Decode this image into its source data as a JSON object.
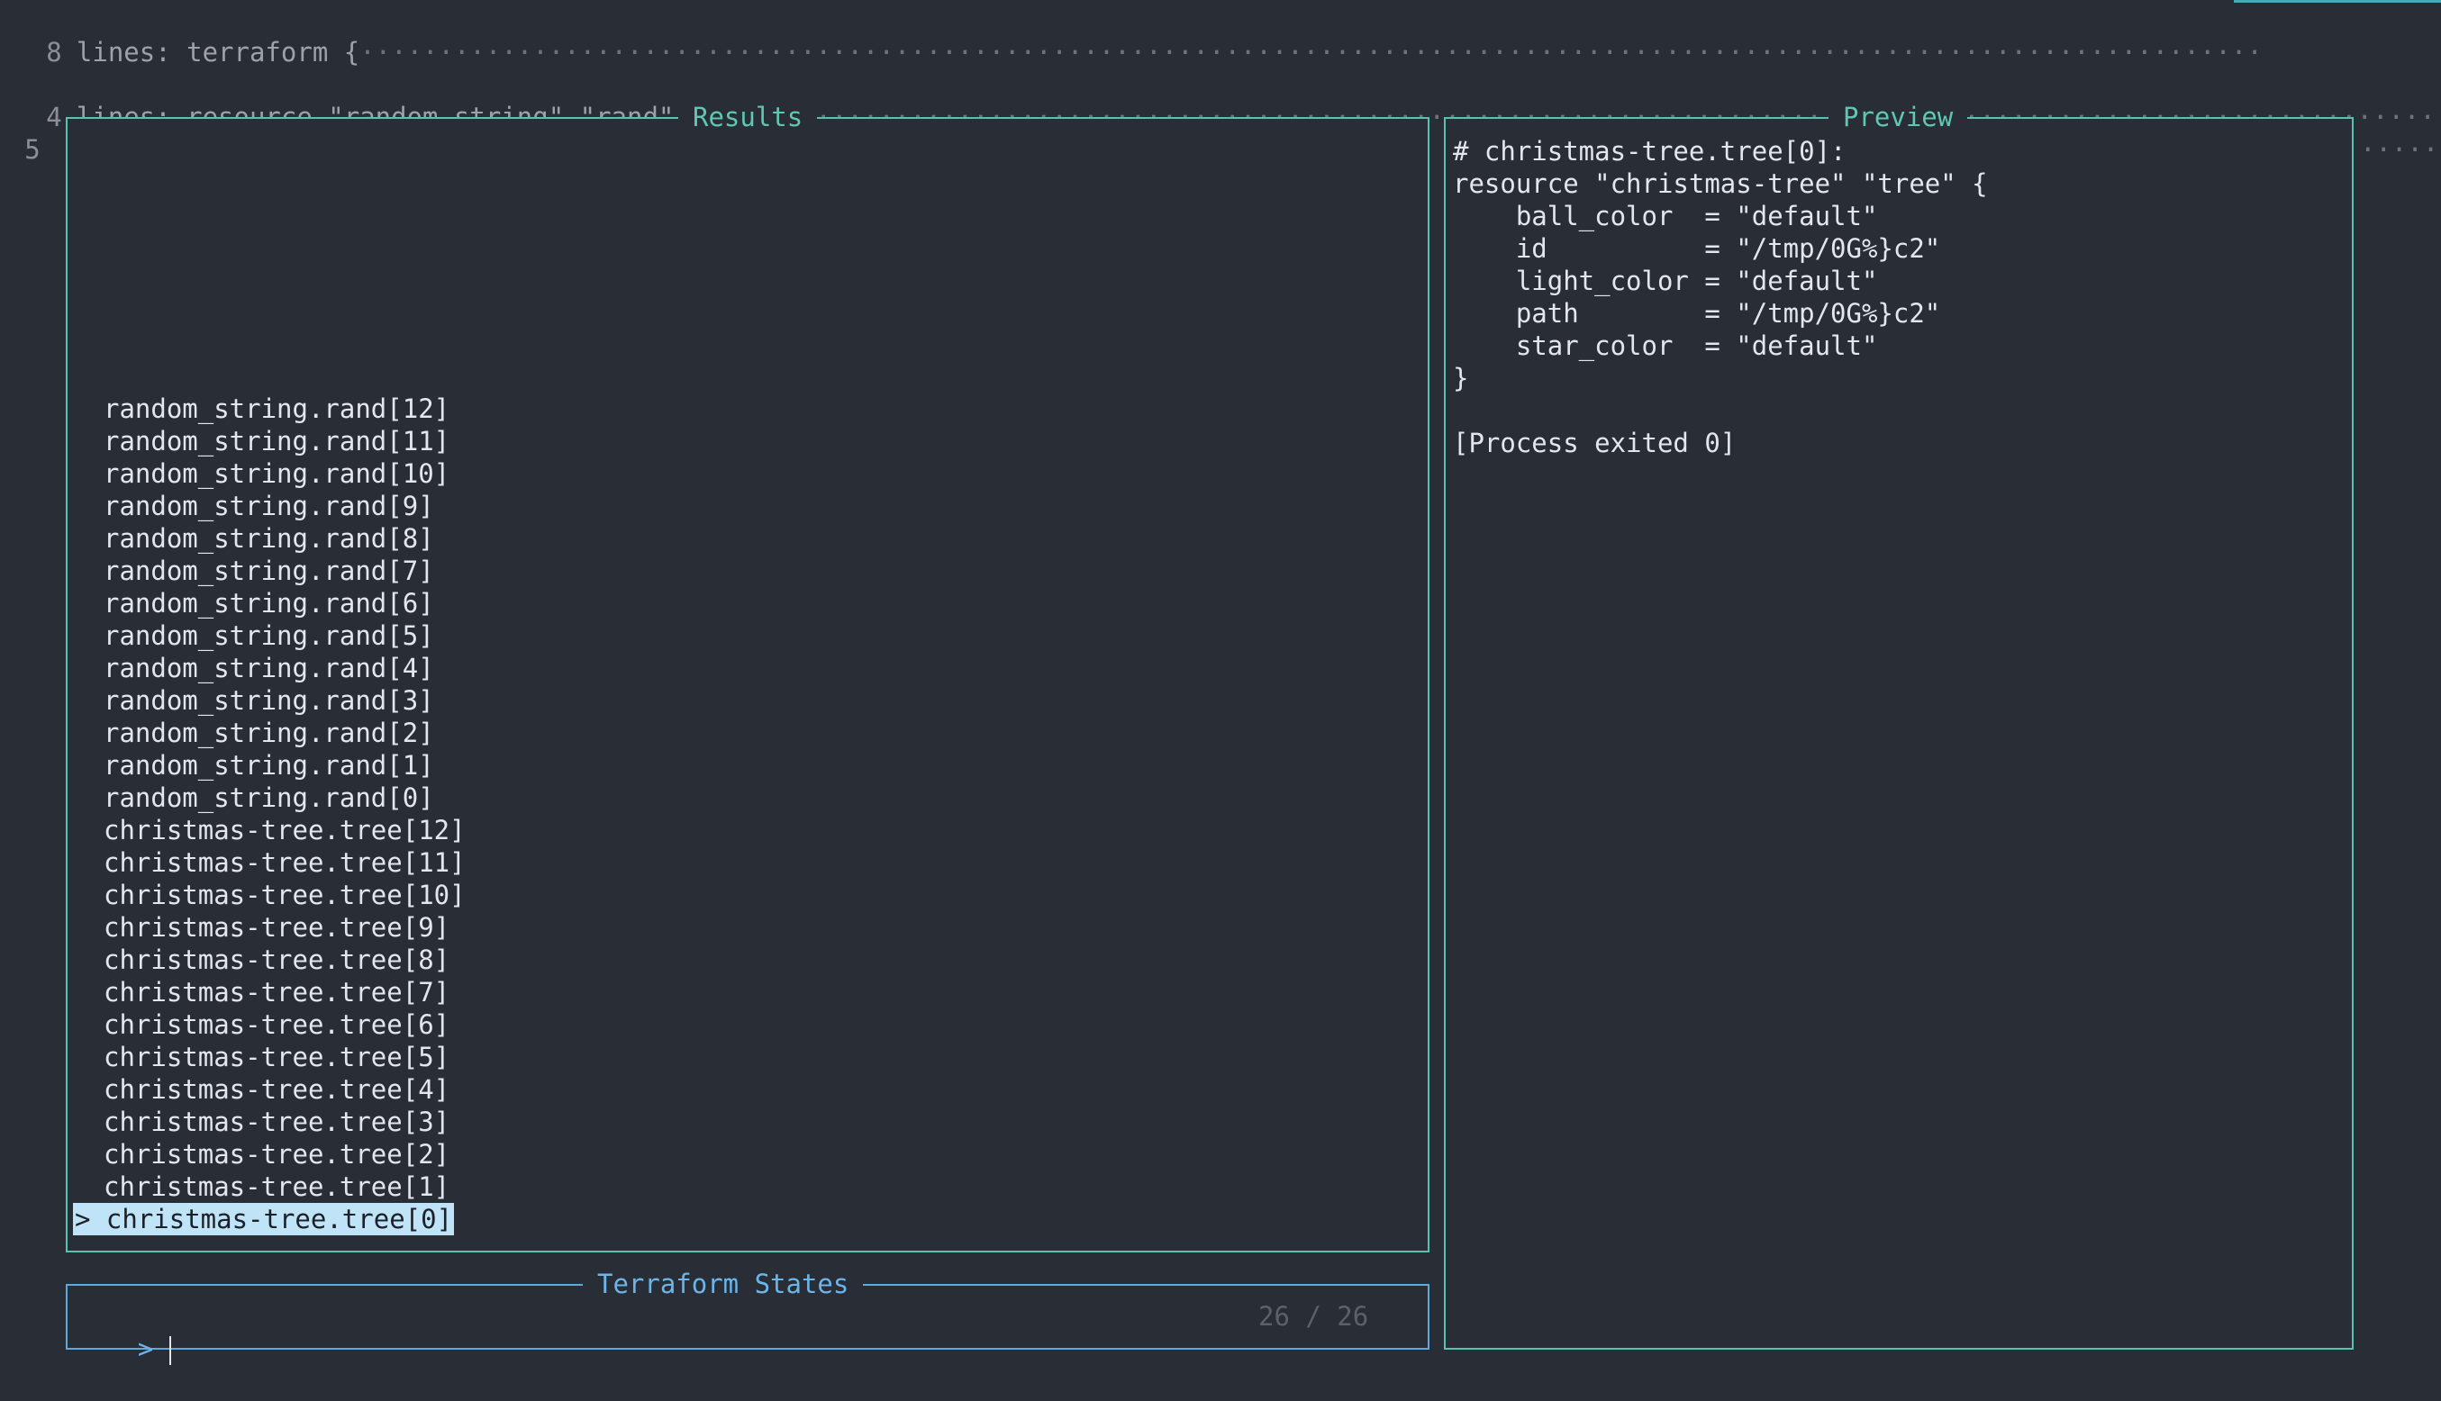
{
  "editor": {
    "fold1": {
      "num": "8",
      "text": "lines: terraform {"
    },
    "fold2": {
      "num": "4",
      "text": "lines: resource \"random_string\" \"rand\" {"
    },
    "line5_num": "5"
  },
  "results_panel": {
    "title": "Results",
    "items": [
      "random_string.rand[12]",
      "random_string.rand[11]",
      "random_string.rand[10]",
      "random_string.rand[9]",
      "random_string.rand[8]",
      "random_string.rand[7]",
      "random_string.rand[6]",
      "random_string.rand[5]",
      "random_string.rand[4]",
      "random_string.rand[3]",
      "random_string.rand[2]",
      "random_string.rand[1]",
      "random_string.rand[0]",
      "christmas-tree.tree[12]",
      "christmas-tree.tree[11]",
      "christmas-tree.tree[10]",
      "christmas-tree.tree[9]",
      "christmas-tree.tree[8]",
      "christmas-tree.tree[7]",
      "christmas-tree.tree[6]",
      "christmas-tree.tree[5]",
      "christmas-tree.tree[4]",
      "christmas-tree.tree[3]",
      "christmas-tree.tree[2]",
      "christmas-tree.tree[1]"
    ],
    "selected": "> christmas-tree.tree[0]"
  },
  "preview_panel": {
    "title": "Preview",
    "lines": [
      "# christmas-tree.tree[0]:",
      "resource \"christmas-tree\" \"tree\" {",
      "    ball_color  = \"default\"",
      "    id          = \"/tmp/0G%}c2\"",
      "    light_color = \"default\"",
      "    path        = \"/tmp/0G%}c2\"",
      "    star_color  = \"default\"",
      "}",
      "",
      "[Process exited 0]"
    ]
  },
  "search": {
    "title": "Terraform States",
    "prompt": ">",
    "value": "",
    "counter": "26 / 26"
  },
  "colors": {
    "background": "#292d36",
    "panel_border": "#56c2b0",
    "search_border": "#5aaadd",
    "selection_bg": "#bfe3f7"
  }
}
